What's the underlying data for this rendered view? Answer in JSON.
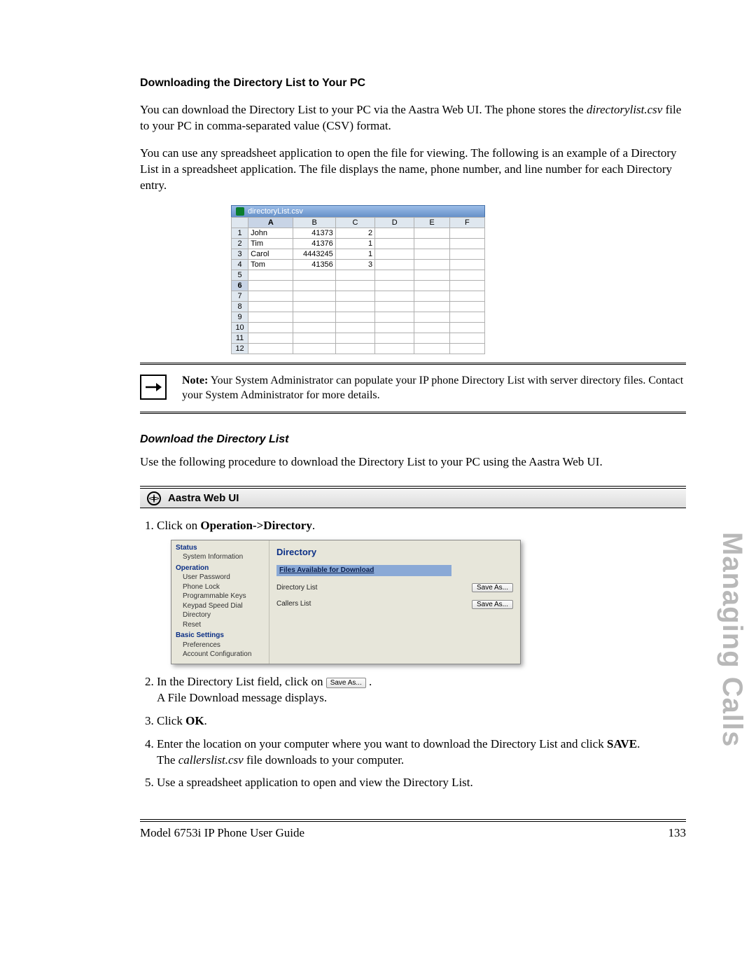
{
  "sideLabel": "Managing Calls",
  "heading1": "Downloading the Directory List to Your PC",
  "para1a": "You can download the Directory List to your PC via the Aastra Web UI. The phone stores the ",
  "para1_filename": "directorylist.csv",
  "para1b": " file to your PC in comma-separated value (CSV) format.",
  "para2": "You can use any spreadsheet application to open the file for viewing. The following is an example of a Directory List in a spreadsheet application. The file displays the name, phone number, and line number for each Directory entry.",
  "spreadsheet": {
    "title": "directoryList.csv",
    "cols": [
      "A",
      "B",
      "C",
      "D",
      "E",
      "F"
    ],
    "rowCount": 12,
    "selectedRow": 6,
    "rows": [
      {
        "A": "John",
        "B": "41373",
        "C": "2"
      },
      {
        "A": "Tim",
        "B": "41376",
        "C": "1"
      },
      {
        "A": "Carol",
        "B": "4443245",
        "C": "1"
      },
      {
        "A": "Tom",
        "B": "41356",
        "C": "3"
      }
    ]
  },
  "note_prefix": "Note:",
  "note_text": " Your System Administrator can populate your IP phone Directory List with server directory files. Contact your System Administrator for more details.",
  "heading2": "Download the Directory List",
  "para3": "Use the following procedure to download the Directory List to your PC using the Aastra Web UI.",
  "webuiLabel": "Aastra Web UI",
  "step1_a": "Click on ",
  "step1_b": "Operation->Directory",
  "step1_c": ".",
  "webui": {
    "groups": [
      {
        "name": "Status",
        "items": [
          "System Information"
        ]
      },
      {
        "name": "Operation",
        "items": [
          "User Password",
          "Phone Lock",
          "Programmable Keys",
          "Keypad Speed Dial",
          "Directory",
          "Reset"
        ]
      },
      {
        "name": "Basic Settings",
        "items": [
          "Preferences",
          "Account Configuration"
        ]
      }
    ],
    "title": "Directory",
    "section": "Files Available for Download",
    "rows": [
      {
        "label": "Directory List",
        "button": "Save As..."
      },
      {
        "label": "Callers List",
        "button": "Save As..."
      }
    ]
  },
  "step2_a": "In the Directory List field, click on ",
  "step2_btn": "Save As...",
  "step2_b": ".",
  "step2_line2": "A File Download message displays.",
  "step3_a": "Click ",
  "step3_b": "OK",
  "step3_c": ".",
  "step4_a": "Enter the location on your computer where you want to download the Directory List and click ",
  "step4_b": "SAVE",
  "step4_c": ".",
  "step4_line2a": "The ",
  "step4_file": "callerslist.csv",
  "step4_line2b": " file downloads to your computer.",
  "step5": "Use a spreadsheet application to open and view the Directory List.",
  "footerLeft": "Model 6753i IP Phone User Guide",
  "footerRight": "133"
}
